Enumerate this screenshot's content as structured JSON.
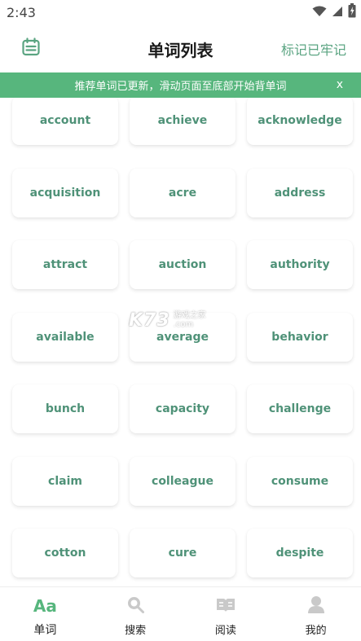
{
  "status_bar": {
    "time": "2:43",
    "icons": [
      "wifi-icon",
      "signal-icon",
      "battery-icon"
    ]
  },
  "header": {
    "title": "单词列表",
    "left_icon": "calendar-icon",
    "right_action": "标记已牢记"
  },
  "notice": {
    "text": "推荐单词已更新，滑动页面至底部开始背单词",
    "close": "x"
  },
  "words": [
    "account",
    "achieve",
    "acknowledge",
    "acquisition",
    "acre",
    "address",
    "attract",
    "auction",
    "authority",
    "available",
    "average",
    "behavior",
    "bunch",
    "capacity",
    "challenge",
    "claim",
    "colleague",
    "consume",
    "cotton",
    "cure",
    "despite"
  ],
  "watermark": {
    "logo": "K73",
    "line1": "游戏之家",
    "line2": ".com"
  },
  "bottom_nav": [
    {
      "icon": "aa-icon",
      "icon_text": "Aa",
      "label": "单词",
      "active": true
    },
    {
      "icon": "search-icon",
      "label": "搜索",
      "active": false
    },
    {
      "icon": "reading-icon",
      "label": "阅读",
      "active": false
    },
    {
      "icon": "profile-icon",
      "label": "我的",
      "active": false
    }
  ],
  "colors": {
    "accent": "#57b67d",
    "word_text": "#4f9278",
    "header_action": "#5aa481"
  }
}
